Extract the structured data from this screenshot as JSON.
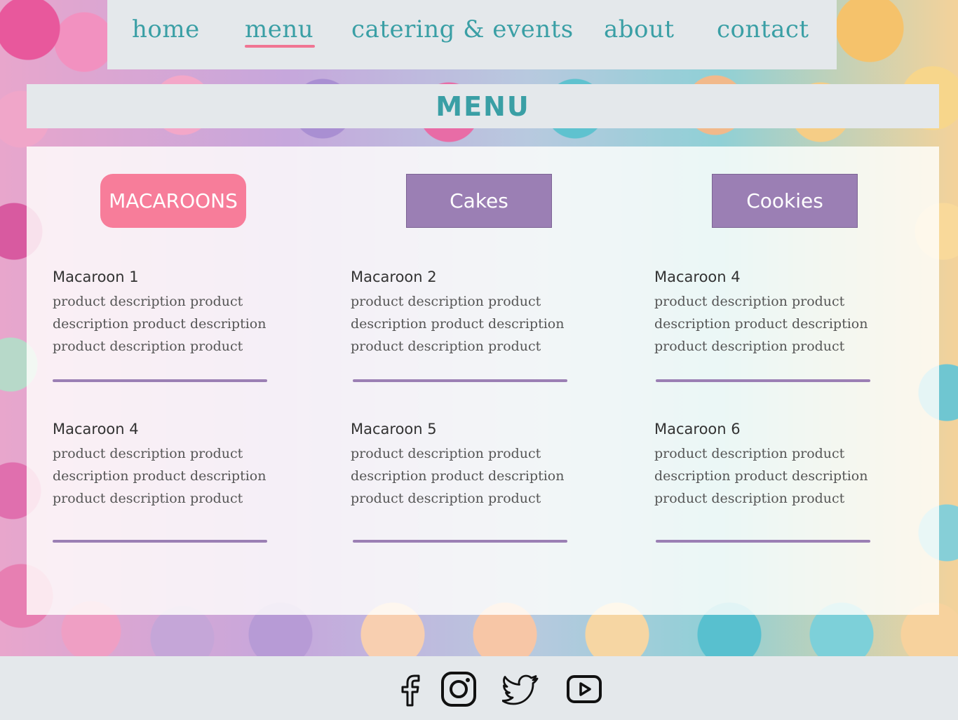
{
  "nav": {
    "items": [
      {
        "label": "home"
      },
      {
        "label": "menu"
      },
      {
        "label": "catering & events"
      },
      {
        "label": "about"
      },
      {
        "label": "contact"
      }
    ],
    "active": "menu"
  },
  "page": {
    "title": "MENU"
  },
  "categories": [
    {
      "label": "MACAROONS",
      "active": true
    },
    {
      "label": "Cakes",
      "active": false
    },
    {
      "label": "Cookies",
      "active": false
    }
  ],
  "products": [
    {
      "name": "Macaroon 1",
      "description": "product description product description product description product description product"
    },
    {
      "name": "Macaroon 2",
      "description": "product description product description product description product description product"
    },
    {
      "name": "Macaroon 4",
      "description": "product description product description product description product description product"
    },
    {
      "name": "Macaroon 4",
      "description": "product description product description product description product description product"
    },
    {
      "name": "Macaroon 5",
      "description": "product description product description product description product description product"
    },
    {
      "name": "Macaroon 6",
      "description": "product description product description product description product description product"
    }
  ],
  "footer": {
    "social": [
      "facebook-icon",
      "instagram-icon",
      "twitter-icon",
      "youtube-icon"
    ]
  },
  "colors": {
    "accent_teal": "#3a9fa5",
    "active_pink": "#f77d9a",
    "category_purple": "#9b7fb4",
    "bar_gray": "#e4e8eb"
  }
}
